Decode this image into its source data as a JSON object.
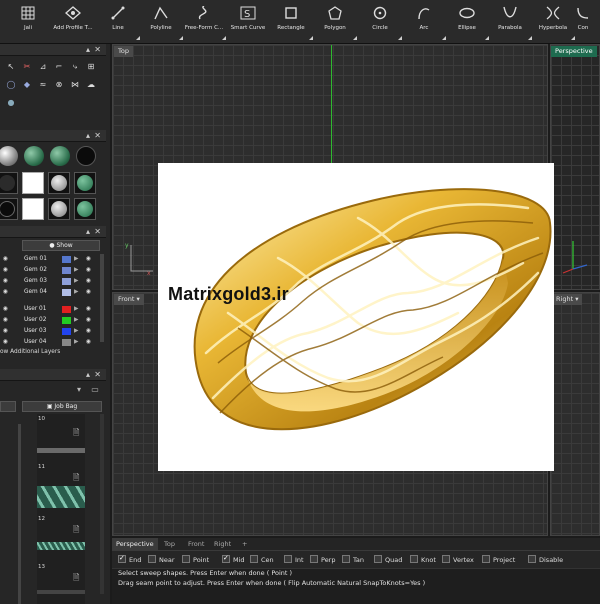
{
  "toolbar": {
    "tools": [
      {
        "label": "Jali",
        "icon": "jali-icon",
        "dropdown": false
      },
      {
        "label": "Add Profile T...",
        "icon": "add-profile-icon",
        "dropdown": false
      },
      {
        "label": "Line",
        "icon": "line-icon",
        "dropdown": true
      },
      {
        "label": "Polyline",
        "icon": "polyline-icon",
        "dropdown": true
      },
      {
        "label": "Free-Form C...",
        "icon": "freeform-curve-icon",
        "dropdown": true
      },
      {
        "label": "Smart Curve",
        "icon": "smart-curve-icon",
        "dropdown": false
      },
      {
        "label": "Rectangle",
        "icon": "rectangle-icon",
        "dropdown": true
      },
      {
        "label": "Polygon",
        "icon": "polygon-icon",
        "dropdown": true
      },
      {
        "label": "Circle",
        "icon": "circle-icon",
        "dropdown": true
      },
      {
        "label": "Arc",
        "icon": "arc-icon",
        "dropdown": true
      },
      {
        "label": "Ellipse",
        "icon": "ellipse-icon",
        "dropdown": true
      },
      {
        "label": "Parabola",
        "icon": "parabola-icon",
        "dropdown": true
      },
      {
        "label": "Hyperbola",
        "icon": "hyperbola-icon",
        "dropdown": true
      },
      {
        "label": "Con",
        "icon": "conic-icon",
        "dropdown": false
      }
    ]
  },
  "layers": {
    "show_label": "Show",
    "items": [
      {
        "name": "Gem 01",
        "color": "#5577cc"
      },
      {
        "name": "Gem 02",
        "color": "#6f86d0"
      },
      {
        "name": "Gem 03",
        "color": "#8ea0da"
      },
      {
        "name": "Gem 04",
        "color": "#b0bde6"
      },
      {
        "name": "User 01",
        "color": "#e02020"
      },
      {
        "name": "User 02",
        "color": "#22cc22"
      },
      {
        "name": "User 03",
        "color": "#2244ee"
      },
      {
        "name": "User 04",
        "color": "#888888"
      }
    ],
    "additional": "ow Additional Layers"
  },
  "job_bag": {
    "label": "Job Bag",
    "items": [
      "10",
      "11",
      "12",
      "13"
    ]
  },
  "viewports": {
    "top": "Top",
    "front": "Front",
    "right": "Right",
    "perspective": "Perspective"
  },
  "overlay": {
    "brand_text": "Matrixgold3.ir"
  },
  "viewport_tabs": [
    "Perspective",
    "Top",
    "Front",
    "Right",
    "+"
  ],
  "snaps": [
    {
      "label": "End",
      "checked": true
    },
    {
      "label": "Near",
      "checked": false
    },
    {
      "label": "Point",
      "checked": false
    },
    {
      "label": "Mid",
      "checked": true
    },
    {
      "label": "Cen",
      "checked": false
    },
    {
      "label": "Int",
      "checked": false
    },
    {
      "label": "Perp",
      "checked": false
    },
    {
      "label": "Tan",
      "checked": false
    },
    {
      "label": "Quad",
      "checked": false
    },
    {
      "label": "Knot",
      "checked": false
    },
    {
      "label": "Vertex",
      "checked": false
    },
    {
      "label": "Project",
      "checked": false
    },
    {
      "label": "Disable",
      "checked": false
    }
  ],
  "command": {
    "line1": "Select sweep shapes. Press Enter when done ( Point )",
    "line2": "Drag seam point to adjust. Press Enter when done ( Flip  Automatic  Natural  SnapToKnots=Yes )"
  },
  "colors": {
    "perspective_tab": "#1e6b4f",
    "gold": "#e2ad2e",
    "axis_x": "#cc3030",
    "axis_y": "#30c030"
  }
}
